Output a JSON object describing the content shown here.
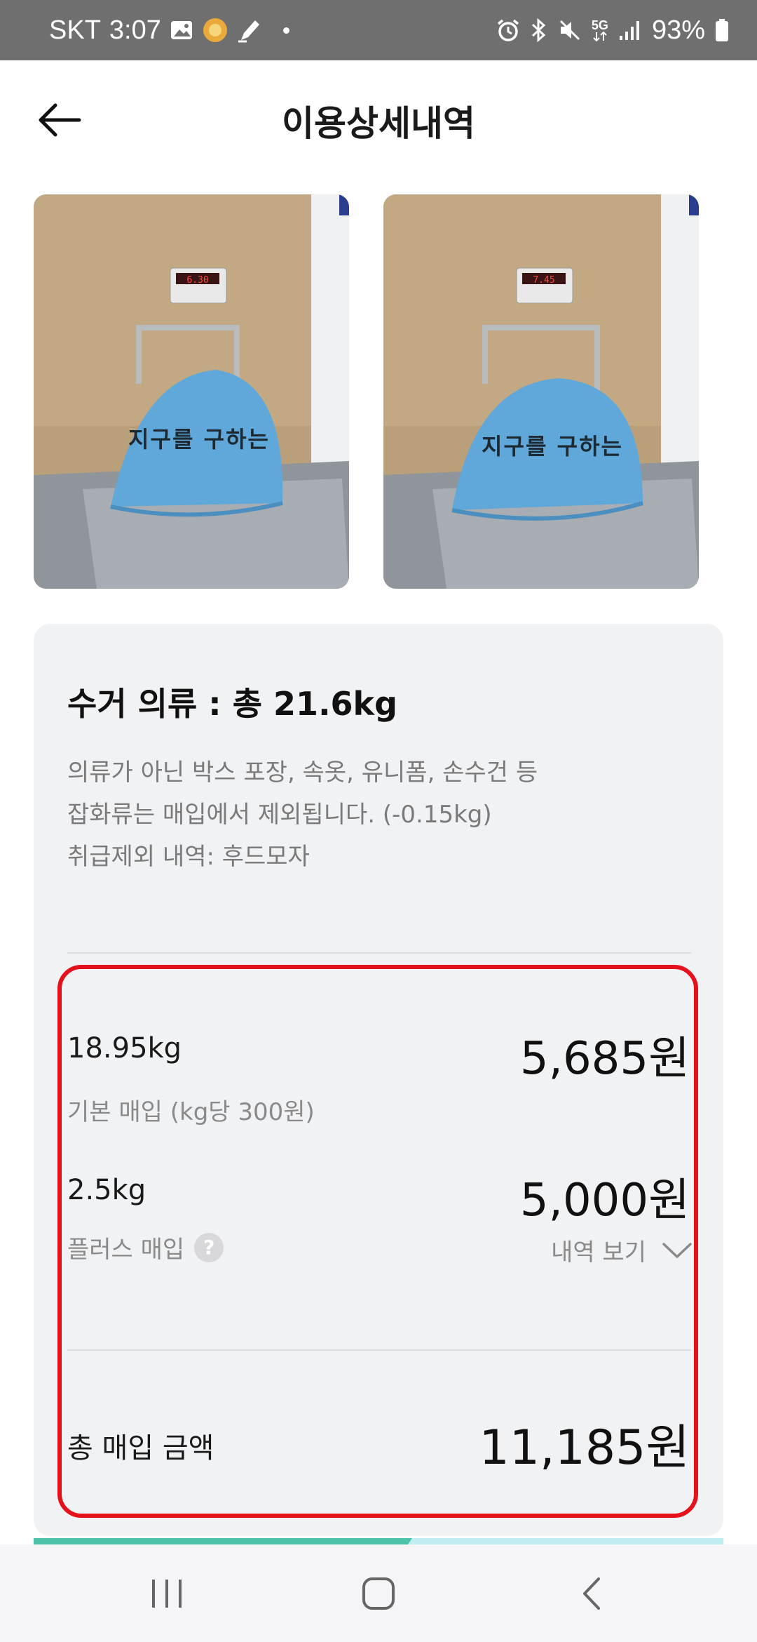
{
  "status_bar": {
    "carrier": "SKT",
    "time": "3:07",
    "network": "5G",
    "battery": "93%"
  },
  "header": {
    "title": "이용상세내역"
  },
  "photos": [
    {
      "scale_reading": "6.30",
      "bag_text": "지구를 구하는"
    },
    {
      "scale_reading": "7.45",
      "bag_text": "지구를 구하는"
    }
  ],
  "summary": {
    "title": "수거 의류 : 총 21.6kg",
    "notice_line1": "의류가 아닌 박스 포장, 속옷, 유니폼, 손수건 등",
    "notice_line2": "잡화류는 매입에서 제외됩니다. (-0.15kg)",
    "notice_line3": "취급제외 내역: 후드모자"
  },
  "purchase": {
    "basic": {
      "weight": "18.95kg",
      "label": "기본 매입 (kg당 300원)",
      "amount": "5,685원"
    },
    "plus": {
      "weight": "2.5kg",
      "label": "플러스 매입",
      "help": "?",
      "amount": "5,000원",
      "detail_link": "내역 보기"
    },
    "total": {
      "label": "총 매입 금액",
      "amount": "11,185원"
    }
  },
  "colors": {
    "highlight_border": "#e5121c",
    "card_background": "#f1f2f4",
    "accent_teal": "#4cc3a8",
    "accent_light": "#bfeef2"
  },
  "nav": {
    "recent": "recent-apps-icon",
    "home": "home-icon",
    "back": "back-icon"
  }
}
